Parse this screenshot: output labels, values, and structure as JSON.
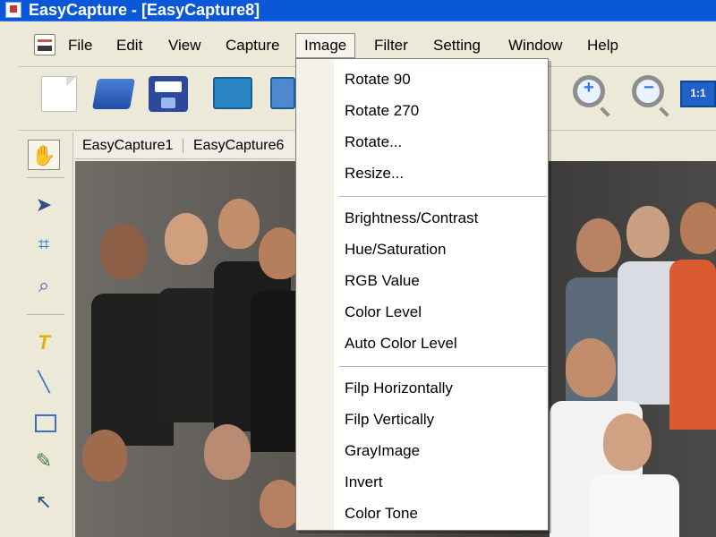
{
  "window": {
    "title": "EasyCapture - [EasyCapture8]"
  },
  "menubar": {
    "items": [
      {
        "label": "File"
      },
      {
        "label": "Edit"
      },
      {
        "label": "View"
      },
      {
        "label": "Capture"
      },
      {
        "label": "Image",
        "active": true
      },
      {
        "label": "Filter"
      },
      {
        "label": "Setting"
      },
      {
        "label": "Window"
      },
      {
        "label": "Help"
      }
    ]
  },
  "toolbar": {
    "icons": [
      "new-document-icon",
      "open-folder-icon",
      "save-disk-icon",
      "capture-window-icon",
      "capture-region-icon",
      "zoom-in-icon",
      "zoom-out-icon",
      "actual-size-icon"
    ],
    "actual_size_label": "1:1"
  },
  "tabs": [
    {
      "label": "EasyCapture1"
    },
    {
      "label": "EasyCapture6"
    }
  ],
  "image_menu": {
    "groups": [
      [
        "Rotate 90",
        "Rotate 270",
        "Rotate...",
        "Resize..."
      ],
      [
        "Brightness/Contrast",
        "Hue/Saturation",
        "RGB Value",
        "Color Level",
        "Auto Color Level"
      ],
      [
        "Filp Horizontally",
        "Filp Vertically",
        "GrayImage",
        "Invert",
        "Color Tone"
      ]
    ]
  },
  "left_tools": [
    "hand-tool-icon",
    "pointer-move-icon",
    "crop-icon",
    "magnifier-icon",
    "text-tool-icon",
    "line-tool-icon",
    "rectangle-tool-icon",
    "eraser-icon",
    "arrow-tool-icon"
  ],
  "colors": {
    "titlebar": "#0a57d8",
    "window_bg": "#ece9d8",
    "menu_bg": "#ffffff",
    "menu_border": "#7f7b70"
  }
}
